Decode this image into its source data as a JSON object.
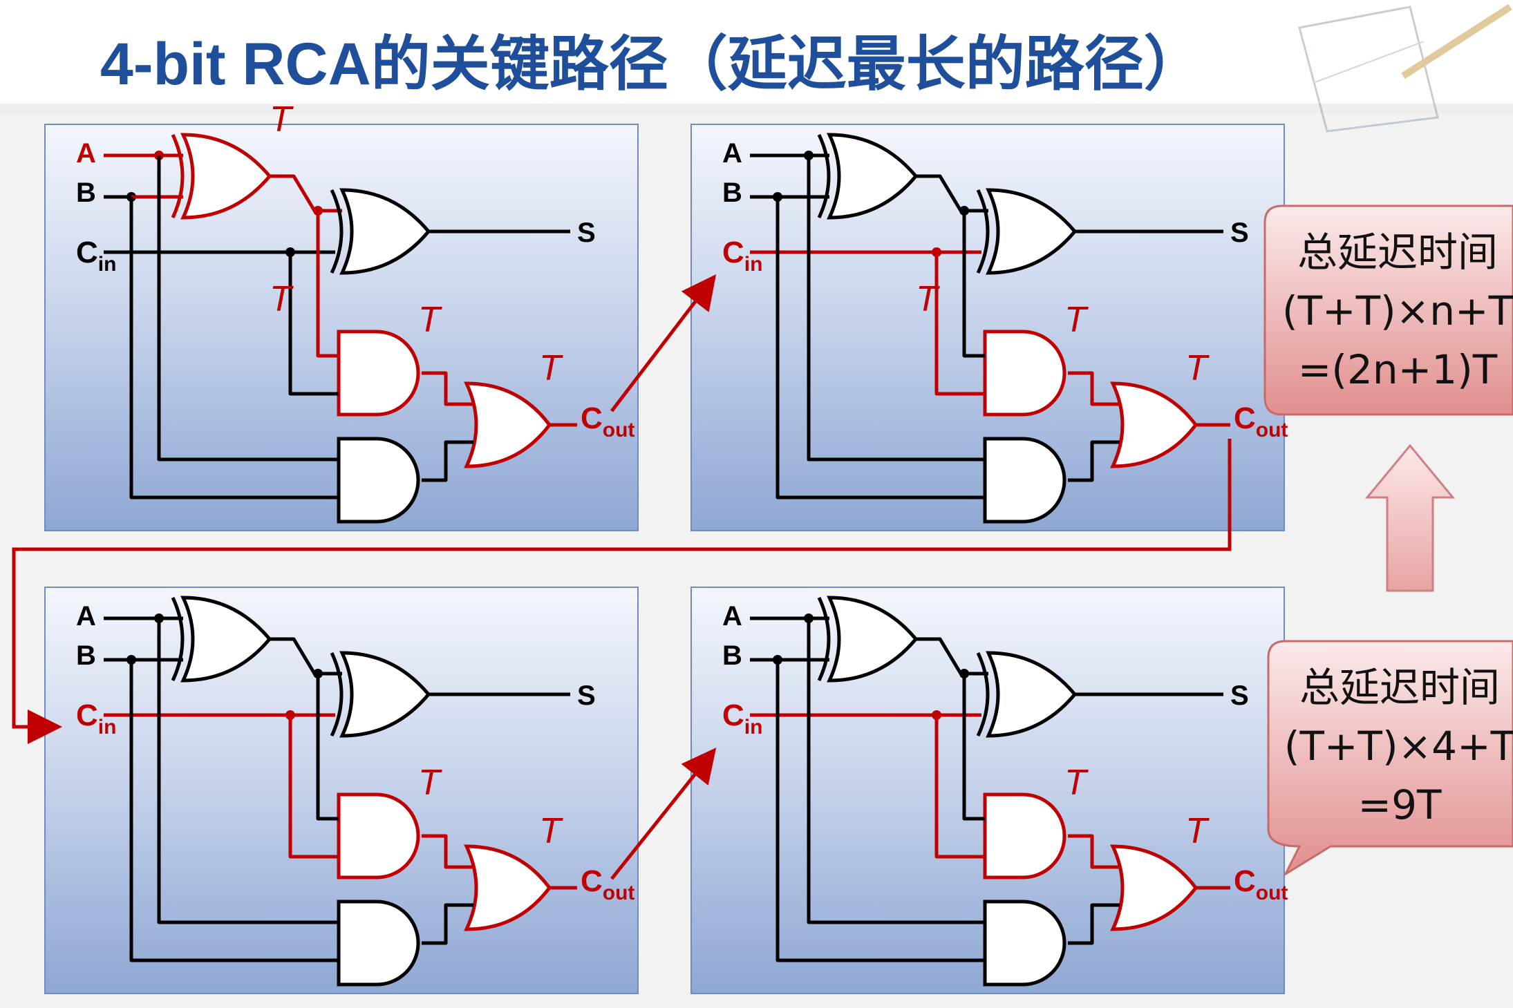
{
  "title": "4-bit RCA的关键路径（延迟最长的路径）",
  "labels": {
    "A": "A",
    "B": "B",
    "C": "C",
    "in": "in",
    "out": "out",
    "S": "S",
    "T": "T"
  },
  "callout_general": {
    "line1": "总延迟时间",
    "line2": "(T+T)×n+T",
    "line3": "=(2n+1)T"
  },
  "callout_specific": {
    "line1": "总延迟时间",
    "line2": "(T+T)×4+T",
    "line3": "=9T"
  },
  "colors": {
    "title": "#1f4e9a",
    "critical_path": "#c00000",
    "wire": "#000000",
    "panel_top": "#e9eef8",
    "panel_bottom": "#8fa8d3",
    "callout": "#e79a9a"
  }
}
